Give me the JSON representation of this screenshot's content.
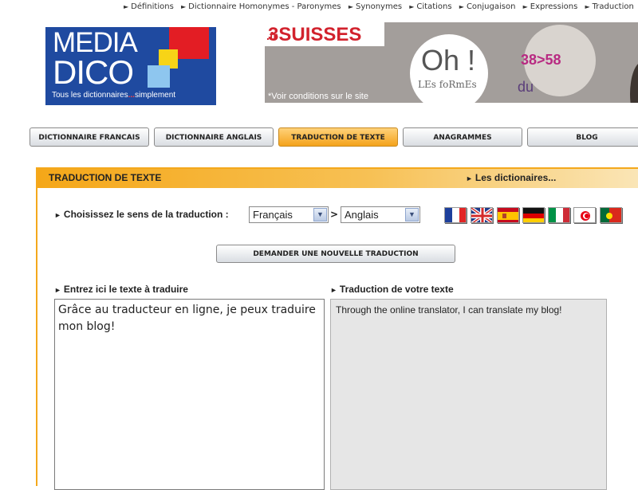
{
  "top_nav": [
    "Définitions",
    "Dictionnaire Homonymes - Paronymes",
    "Synonymes",
    "Citations",
    "Conjugaison",
    "Expressions",
    "Traduction"
  ],
  "logo": {
    "line1": "MEDIA",
    "line2": "DICO",
    "tagline_a": "Tous les dictionnaires",
    "tagline_dots": "...",
    "tagline_b": "simplement"
  },
  "banner": {
    "brand": "3SUISSES",
    "brand_suffix": ".fr",
    "oh": "Oh !",
    "forms": "LEs foRmEs",
    "size_prefix": "du ",
    "size_range": "38>58",
    "note": "*Voir conditions sur le site"
  },
  "menu": [
    {
      "label": "DICTIONNAIRE FRANCAIS",
      "active": false
    },
    {
      "label": "DICTIONNAIRE ANGLAIS",
      "active": false
    },
    {
      "label": "TRADUCTION DE TEXTE",
      "active": true
    },
    {
      "label": "ANAGRAMMES",
      "active": false
    },
    {
      "label": "BLOG",
      "active": false
    }
  ],
  "panel": {
    "title": "TRADUCTION DE TEXTE",
    "dictionaries_link": "Les dictionaires...",
    "direction_label": "Choisissez le sens de la traduction :",
    "source_lang": "Français",
    "separator": ">",
    "target_lang": "Anglais",
    "flags": [
      "french-flag",
      "uk-us-flag",
      "spanish-flag",
      "german-flag",
      "italian-flag",
      "tunisian-flag",
      "portuguese-flag"
    ],
    "new_translation_button": "DEMANDER UNE NOUVELLE TRADUCTION",
    "input_label": "Entrez ici le texte à traduire",
    "output_label": "Traduction de votre texte",
    "input_text": "Grâce au traducteur en ligne, je peux traduire mon blog!",
    "output_text": "Through the online translator, I can translate my blog!"
  },
  "colors": {
    "accent_orange": "#f5a718",
    "logo_blue": "#1f4aa0",
    "brand_red": "#d2222d"
  }
}
